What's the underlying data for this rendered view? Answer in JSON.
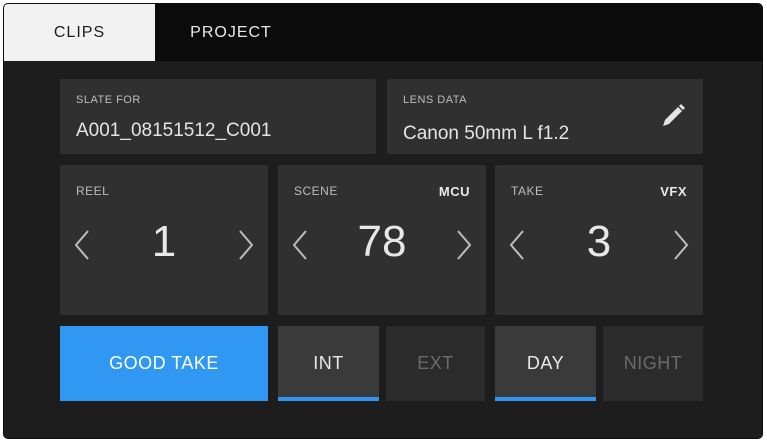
{
  "tabs": [
    {
      "label": "CLIPS"
    },
    {
      "label": "PROJECT"
    }
  ],
  "slate_for": {
    "label": "SLATE FOR",
    "value": "A001_08151512_C001"
  },
  "lens_data": {
    "label": "LENS DATA",
    "value": "Canon 50mm L f1.2",
    "icon": "pencil-icon"
  },
  "reel": {
    "label": "REEL",
    "value": "1"
  },
  "scene": {
    "label": "SCENE",
    "tag": "MCU",
    "value": "78"
  },
  "take": {
    "label": "TAKE",
    "tag": "VFX",
    "value": "3"
  },
  "buttons": {
    "good_take": "GOOD TAKE",
    "int": "INT",
    "ext": "EXT",
    "day": "DAY",
    "night": "NIGHT"
  },
  "colors": {
    "accent": "#3098f3",
    "background": "#1d1d1d",
    "panel": "#303030"
  }
}
